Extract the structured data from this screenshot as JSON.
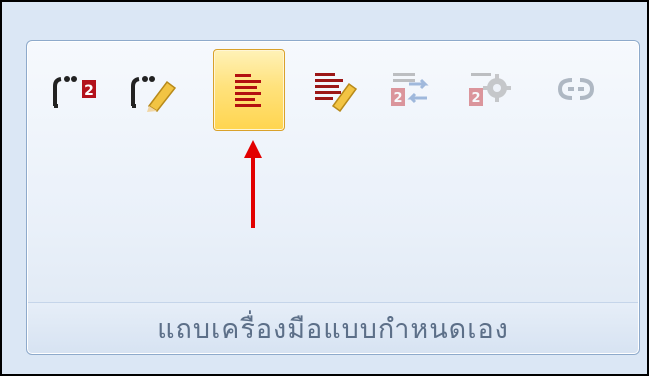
{
  "ribbon_group": {
    "label": "แถบเครื่องมือแบบกำหนดเอง",
    "buttons": [
      {
        "icon": "insert-quote-icon",
        "state": "normal"
      },
      {
        "icon": "edit-quote-icon",
        "state": "normal"
      },
      {
        "icon": "insert-text-icon",
        "state": "selected"
      },
      {
        "icon": "edit-text-icon",
        "state": "normal"
      },
      {
        "icon": "convert-quote-icon",
        "state": "disabled"
      },
      {
        "icon": "quote-settings-icon",
        "state": "disabled"
      },
      {
        "icon": "unlink-icon",
        "state": "disabled"
      }
    ]
  },
  "colors": {
    "accent_red": "#e20000",
    "selected_fill": "#ffd54f",
    "label_text": "#5c6f88"
  }
}
